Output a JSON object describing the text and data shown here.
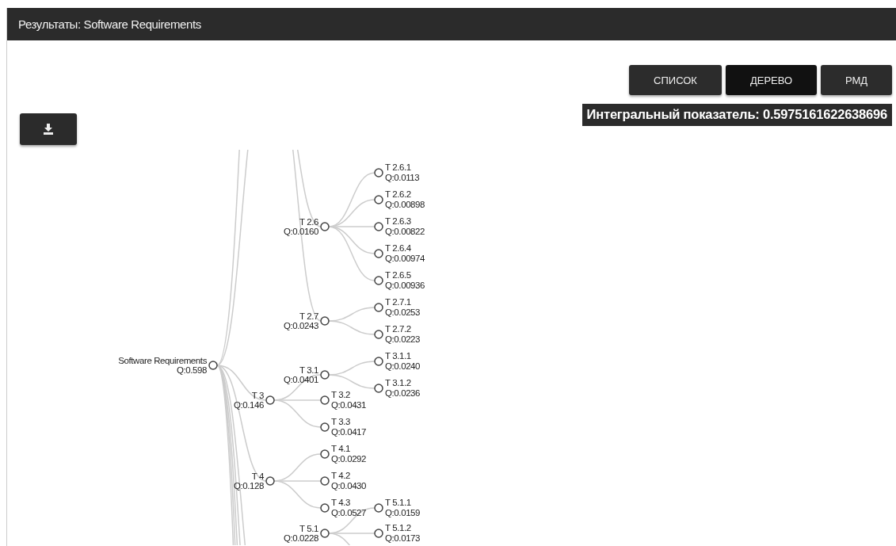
{
  "window": {
    "title": "Результаты: Software Requirements"
  },
  "view_buttons": [
    {
      "label": "СПИСОК",
      "selected": false
    },
    {
      "label": "ДЕРЕВО",
      "selected": true
    },
    {
      "label": "РМД",
      "selected": false
    }
  ],
  "integral_indicator": "Интегральный показатель: 0.5975161622638696",
  "tree": {
    "upper_branches": [
      {
        "name": "T 2.6",
        "value": "Q:0.0160",
        "children": [
          {
            "name": "T 2.6.1",
            "value": "Q:0.0113"
          },
          {
            "name": "T 2.6.2",
            "value": "Q:0.00898"
          },
          {
            "name": "T 2.6.3",
            "value": "Q:0.00822"
          },
          {
            "name": "T 2.6.4",
            "value": "Q:0.00974"
          },
          {
            "name": "T 2.6.5",
            "value": "Q:0.00936"
          }
        ]
      },
      {
        "name": "T 2.7",
        "value": "Q:0.0243",
        "children": [
          {
            "name": "T 2.7.1",
            "value": "Q:0.0253"
          },
          {
            "name": "T 2.7.2",
            "value": "Q:0.0223"
          }
        ]
      }
    ],
    "root": {
      "name": "Software Requirements",
      "value": "Q:0.598",
      "children": [
        {
          "name": "T 3",
          "value": "Q:0.146",
          "children": [
            {
              "name": "T 3.1",
              "value": "Q:0.0401",
              "children": [
                {
                  "name": "T 3.1.1",
                  "value": "Q:0.0240"
                },
                {
                  "name": "T 3.1.2",
                  "value": "Q:0.0236"
                }
              ]
            },
            {
              "name": "T 3.2",
              "value": "Q:0.0431"
            },
            {
              "name": "T 3.3",
              "value": "Q:0.0417"
            }
          ]
        },
        {
          "name": "T 4",
          "value": "Q:0.128",
          "children": [
            {
              "name": "T 4.1",
              "value": "Q:0.0292"
            },
            {
              "name": "T 4.2",
              "value": "Q:0.0430"
            },
            {
              "name": "T 4.3",
              "value": "Q:0.0527"
            }
          ]
        }
      ]
    },
    "lower_branches": [
      {
        "name": "T 5.1",
        "value": "Q:0.0228",
        "children": [
          {
            "name": "T 5.1.1",
            "value": "Q:0.0159"
          },
          {
            "name": "T 5.1.2",
            "value": "Q:0.0173"
          }
        ]
      }
    ]
  }
}
